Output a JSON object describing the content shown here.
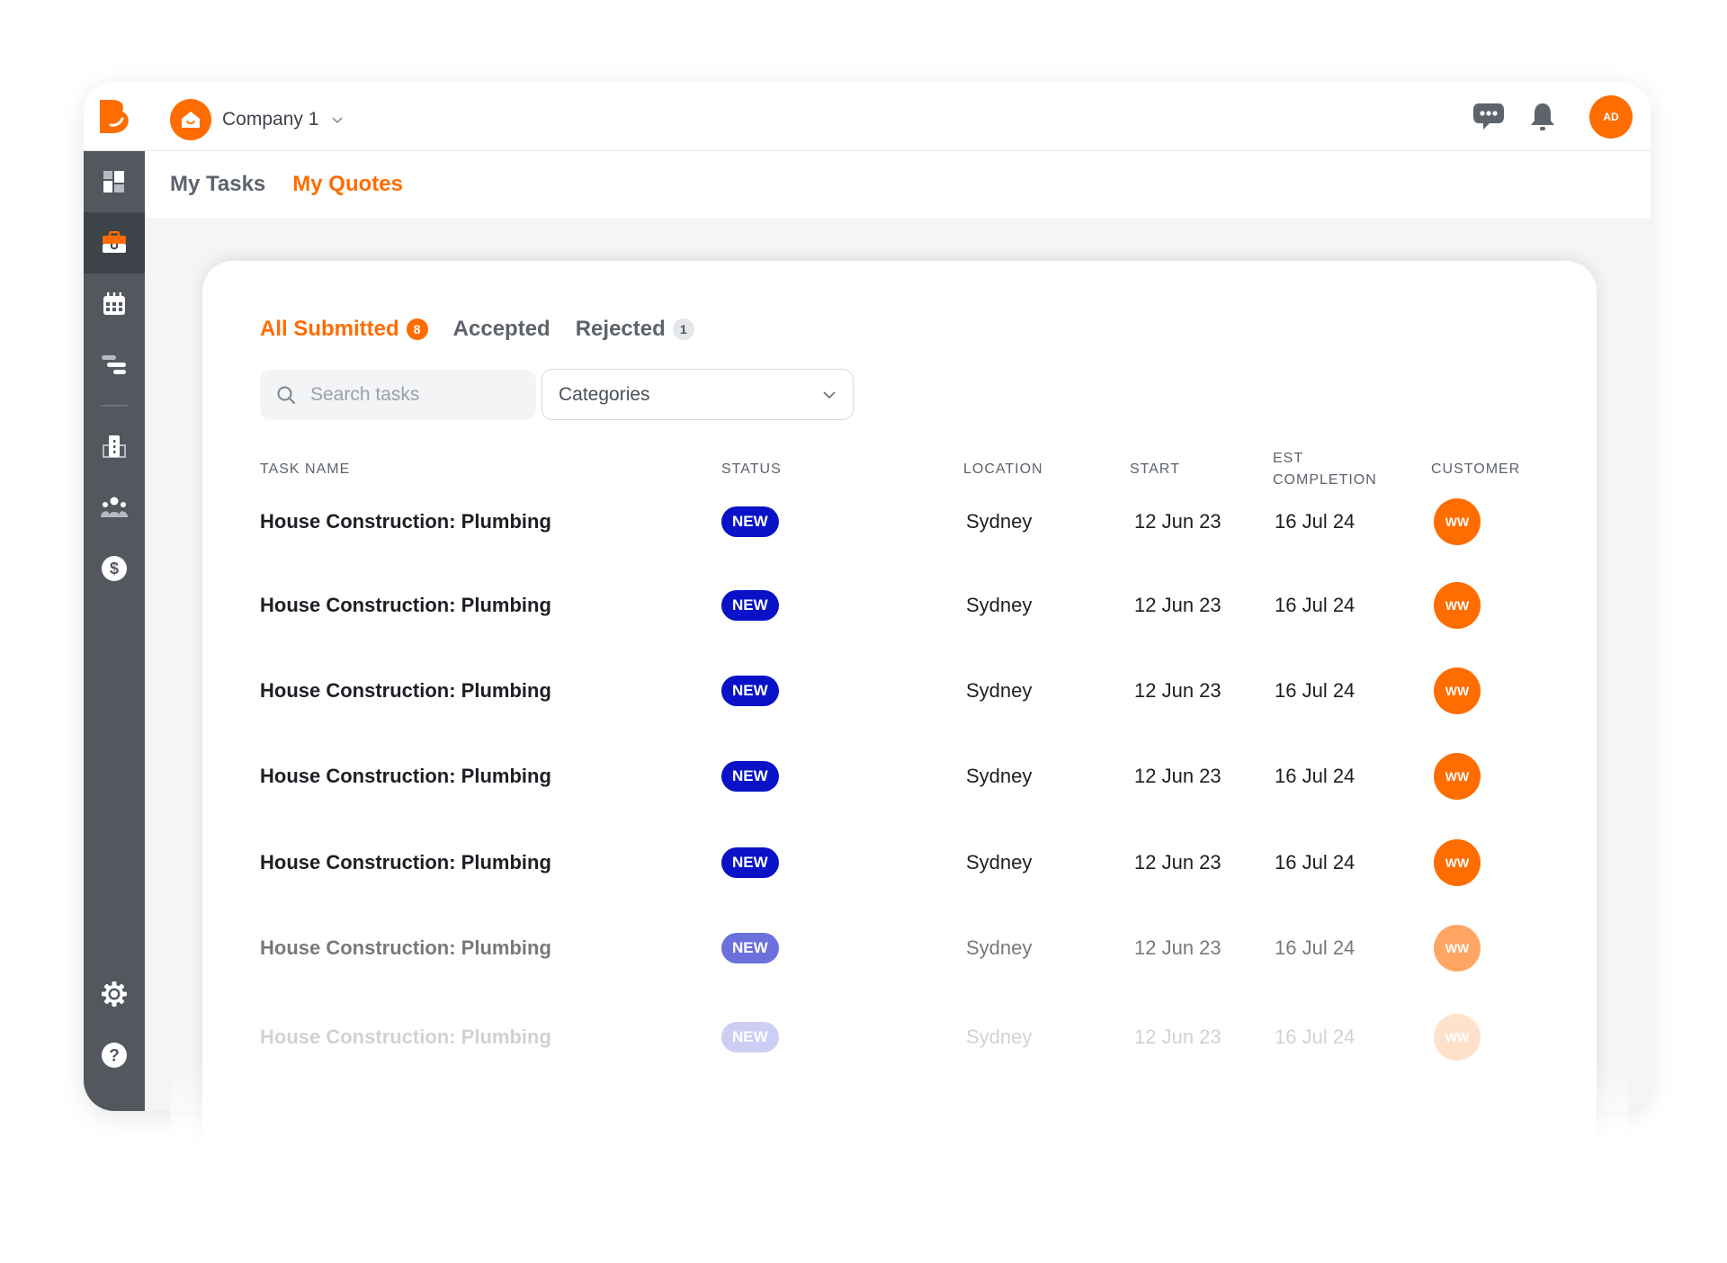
{
  "header": {
    "company_name": "Company 1",
    "user_initials": "AD",
    "icons": [
      "chat-icon",
      "bell-icon"
    ]
  },
  "sidebar": {
    "items": [
      {
        "name": "dashboard",
        "icon": "dashboard-icon",
        "active": false
      },
      {
        "name": "jobs",
        "icon": "briefcase-icon",
        "active": true
      },
      {
        "name": "calendar",
        "icon": "calendar-icon",
        "active": false
      },
      {
        "name": "timeline",
        "icon": "gantt-icon",
        "active": false
      },
      {
        "name": "buildings",
        "icon": "building-icon",
        "active": false
      },
      {
        "name": "team",
        "icon": "team-icon",
        "active": false
      },
      {
        "name": "billing",
        "icon": "dollar-icon",
        "active": false
      }
    ],
    "bottom": [
      {
        "name": "settings",
        "icon": "gear-icon"
      },
      {
        "name": "help",
        "icon": "help-icon"
      }
    ]
  },
  "subnav": {
    "tabs": [
      {
        "label": "My Tasks",
        "active": false
      },
      {
        "label": "My Quotes",
        "active": true
      }
    ]
  },
  "quotes": {
    "tabs": [
      {
        "label": "All Submitted",
        "count": "8",
        "active": true
      },
      {
        "label": "Accepted",
        "count": null,
        "active": false
      },
      {
        "label": "Rejected",
        "count": "1",
        "active": false
      }
    ],
    "search_placeholder": "Search tasks",
    "category_select": "Categories",
    "columns": {
      "task_name": "TASK NAME",
      "status": "STATUS",
      "location": "LOCATION",
      "start": "START",
      "est_completion_1": "EST",
      "est_completion_2": "COMPLETION",
      "customer": "CUSTOMER"
    },
    "rows": [
      {
        "task": "House Construction: Plumbing",
        "status": "NEW",
        "location": "Sydney",
        "start": "12 Jun 23",
        "est_completion": "16 Jul 24",
        "customer": "WW"
      },
      {
        "task": "House Construction: Plumbing",
        "status": "NEW",
        "location": "Sydney",
        "start": "12 Jun 23",
        "est_completion": "16 Jul 24",
        "customer": "WW"
      },
      {
        "task": "House Construction: Plumbing",
        "status": "NEW",
        "location": "Sydney",
        "start": "12 Jun 23",
        "est_completion": "16 Jul 24",
        "customer": "WW"
      },
      {
        "task": "House Construction: Plumbing",
        "status": "NEW",
        "location": "Sydney",
        "start": "12 Jun 23",
        "est_completion": "16 Jul 24",
        "customer": "WW"
      },
      {
        "task": "House Construction: Plumbing",
        "status": "NEW",
        "location": "Sydney",
        "start": "12 Jun 23",
        "est_completion": "16 Jul 24",
        "customer": "WW"
      },
      {
        "task": "House Construction: Plumbing",
        "status": "NEW",
        "location": "Sydney",
        "start": "12 Jun 23",
        "est_completion": "16 Jul 24",
        "customer": "WW"
      },
      {
        "task": "House Construction: Plumbing",
        "status": "NEW",
        "location": "Sydney",
        "start": "12 Jun 23",
        "est_completion": "16 Jul 24",
        "customer": "WW"
      }
    ]
  },
  "colors": {
    "brand": "#ff6c00",
    "status_new": "#0a12c8",
    "sidebar": "#53585f",
    "sidebar_active": "#3e4249"
  }
}
